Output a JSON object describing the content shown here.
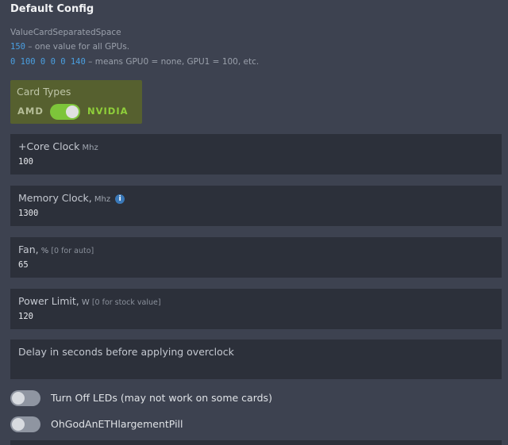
{
  "header": {
    "title": "Default Config"
  },
  "hints": {
    "line1": "ValueCardSeparatedSpace",
    "line2_code": "150",
    "line2_text": " – one value for all GPUs.",
    "line3_code": "0 100 0 0 0 140",
    "line3_text": " – means GPU0 = none, GPU1 = 100, etc."
  },
  "card_types": {
    "label": "Card Types",
    "left_option": "AMD",
    "right_option": "NVIDIA",
    "selected": "NVIDIA"
  },
  "fields": {
    "core_clock": {
      "label": "+Core Clock",
      "unit": " Mhz",
      "value": "100"
    },
    "memory_clock": {
      "label": "Memory Clock,",
      "unit": " Mhz",
      "info_glyph": "i",
      "value": "1300"
    },
    "fan": {
      "label": "Fan,",
      "unit": " %",
      "note": " [0 for auto]",
      "value": "65"
    },
    "power_limit": {
      "label": "Power Limit,",
      "unit": " W",
      "note": " [0 for stock value]",
      "value": "120"
    },
    "delay": {
      "label": "Delay in seconds before applying overclock",
      "value": ""
    }
  },
  "switches": {
    "turn_off_leds": {
      "label": "Turn Off LEDs (may not work on some cards)",
      "on": false
    },
    "ethlargement": {
      "label": "OhGodAnETHlargementPill",
      "on": false
    }
  },
  "colors": {
    "background": "#3d4250",
    "field_bg": "#2c303a",
    "card_types_bg": "#56602f",
    "toggle_on": "#7dc53a",
    "toggle_off": "#8f95a1",
    "code_accent": "#4a9fe0"
  }
}
